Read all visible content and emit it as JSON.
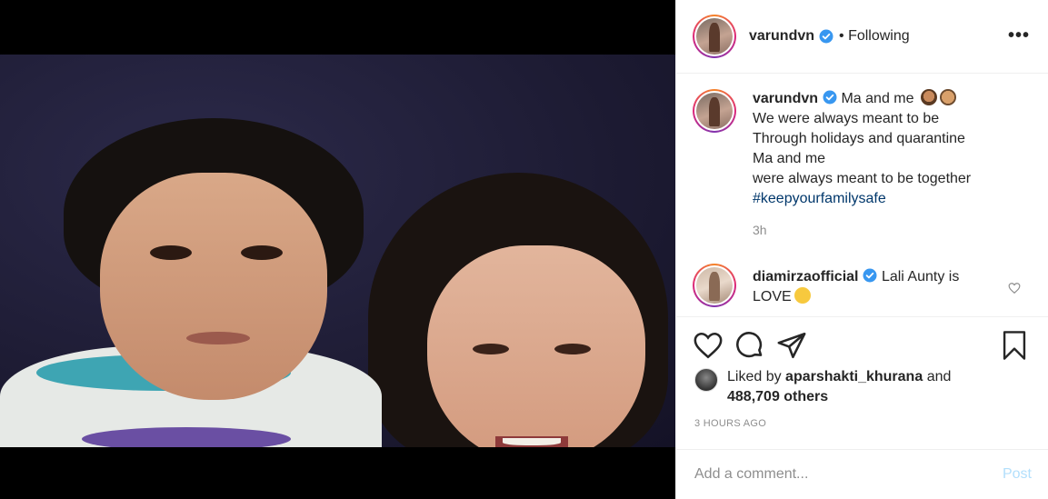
{
  "post": {
    "author": "varundvn",
    "follow_status": "• Following",
    "more_icon": "more-horizontal-icon",
    "image_alt_desc": "childhood photo of a boy with his mother"
  },
  "caption": {
    "username": "varundvn",
    "line1": "Ma and me",
    "line2": "We were always meant to be",
    "line3": "Through holidays and quarantine",
    "line4": "Ma and me",
    "line5": "were always meant to be together",
    "hashtag": "#keepyourfamilysafe",
    "time": "3h"
  },
  "comments": [
    {
      "username": "diamirzaofficial",
      "text": "Lali Aunty is",
      "text2": "LOVE"
    }
  ],
  "actions": {
    "like_icon": "heart-icon",
    "comment_icon": "comment-icon",
    "share_icon": "share-icon",
    "save_icon": "bookmark-icon"
  },
  "likes": {
    "prefix": "Liked by",
    "user": "aparshakti_khurana",
    "suffix": "and",
    "others": "488,709 others"
  },
  "posted_time": "3 HOURS AGO",
  "add_comment": {
    "placeholder": "Add a comment...",
    "post_label": "Post"
  },
  "colors": {
    "verified": "#3897f0",
    "link": "#00376b",
    "post_disabled": "#b2dffc",
    "muted": "#8e8e8e"
  }
}
